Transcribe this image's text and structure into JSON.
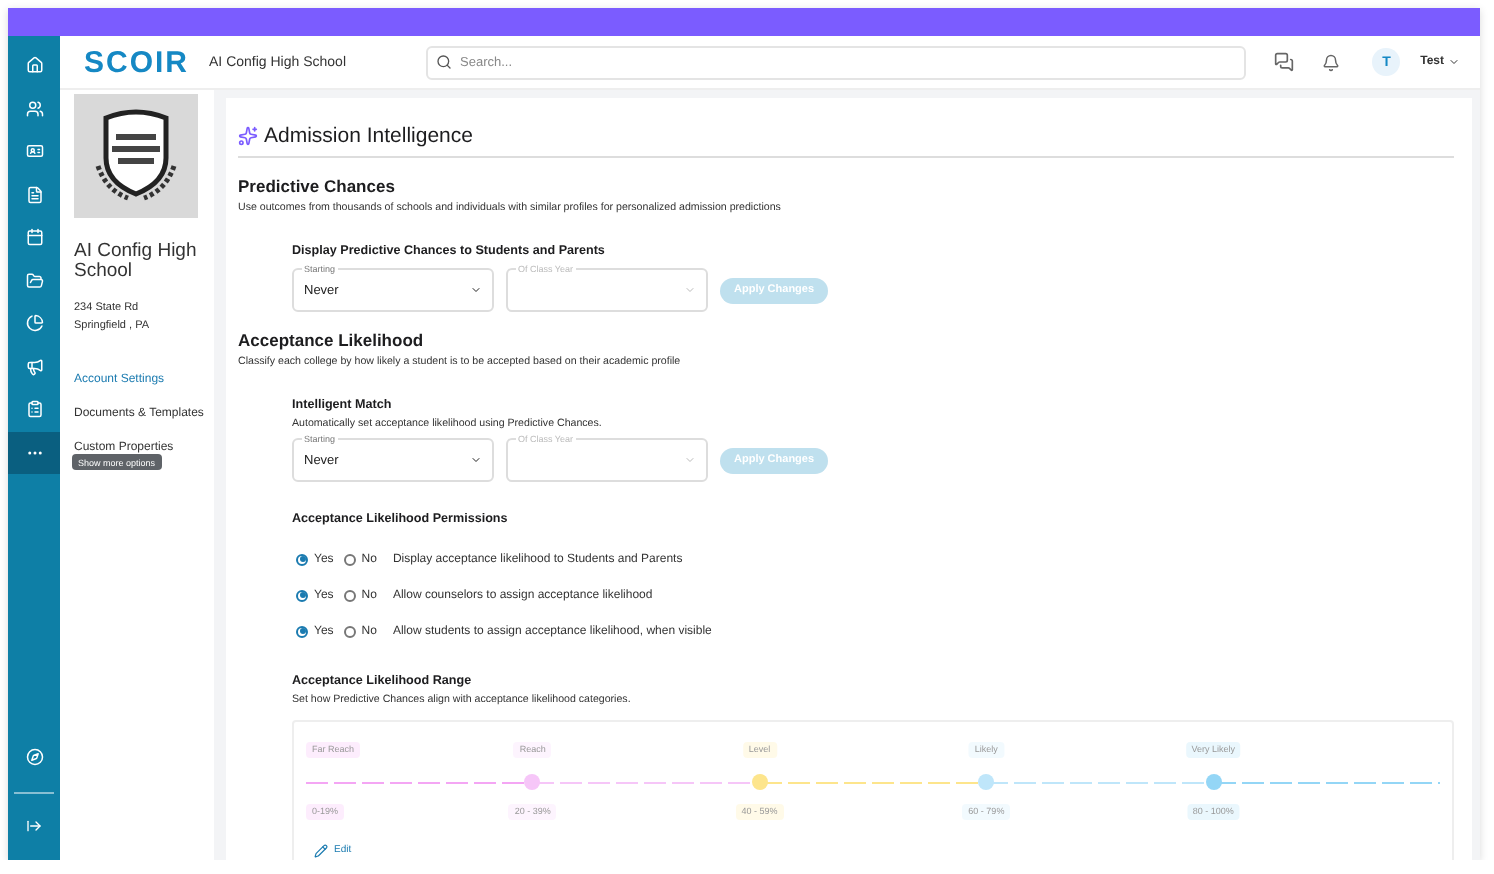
{
  "header": {
    "logo": "SCOIR",
    "school": "AI Config High School",
    "search": {
      "placeholder": "Search..."
    },
    "user": {
      "initial": "T",
      "name": "Test"
    }
  },
  "rail": {
    "items": [
      {
        "selected": false
      },
      {
        "selected": false
      },
      {
        "selected": false
      },
      {
        "selected": false
      },
      {
        "selected": false
      },
      {
        "selected": false
      },
      {
        "selected": false
      },
      {
        "selected": false
      },
      {
        "selected": false
      },
      {
        "selected": true
      }
    ],
    "tooltip": "Show more options"
  },
  "profile": {
    "logo": {
      "kind": "picture"
    },
    "name": "AI Config High School",
    "address": [
      "234 State Rd",
      "Springfield , PA"
    ],
    "links": [
      {
        "label": "Account Settings",
        "selected": true
      },
      {
        "label": "Documents & Templates",
        "selected": false
      },
      {
        "label": "Custom Properties",
        "selected": false
      }
    ]
  },
  "page": {
    "title": "Admission Intelligence",
    "sections": [
      {
        "title": "Predictive Chances",
        "description": "Use outcomes from thousands of schools and individuals with similar profiles for personalized admission predictions",
        "blocks": [
          {
            "kind": "selects",
            "title": "Display Predictive Chances to Students and Parents",
            "selects": [
              {
                "label": "Starting",
                "value": "Never",
                "disabled": false
              },
              {
                "label": "Of Class Year",
                "disabled": true
              }
            ],
            "button": {
              "label": "Apply Changes",
              "disabled": true
            }
          }
        ]
      },
      {
        "title": "Acceptance Likelihood",
        "description": "Classify each college by how likely a student is to be accepted based on their academic profile",
        "blocks": [
          {
            "kind": "selects",
            "title": "Intelligent Match",
            "description": "Automatically set acceptance likelihood using Predictive Chances.",
            "selects": [
              {
                "label": "Starting",
                "value": "Never",
                "disabled": false
              },
              {
                "label": "Of Class Year",
                "disabled": true
              }
            ],
            "button": {
              "label": "Apply Changes",
              "disabled": true
            }
          },
          {
            "kind": "radios",
            "title": "Acceptance Likelihood Permissions",
            "rows": [
              {
                "text": "Display acceptance likelihood to Students and Parents",
                "options": [
                  {
                    "label": "Yes",
                    "selected": true
                  },
                  {
                    "label": "No",
                    "selected": false
                  }
                ]
              },
              {
                "text": "Allow counselors to assign acceptance likelihood",
                "options": [
                  {
                    "label": "Yes",
                    "selected": true
                  },
                  {
                    "label": "No",
                    "selected": false
                  }
                ]
              },
              {
                "text": "Allow students to assign acceptance likelihood, when visible",
                "options": [
                  {
                    "label": "Yes",
                    "selected": true
                  },
                  {
                    "label": "No",
                    "selected": false
                  }
                ]
              }
            ]
          },
          {
            "kind": "range",
            "title": "Acceptance Likelihood Range",
            "description": "Set how Predictive Chances align with acceptance likelihood categories.",
            "edit": "Edit",
            "categories": [
              {
                "label": "Far Reach",
                "range": "0-19%",
                "color": "#f4a6f4"
              },
              {
                "label": "Reach",
                "range": "20 - 39%",
                "color": "#f6c6f8",
                "level": 0.2
              },
              {
                "label": "Level",
                "range": "40 - 59%",
                "color": "#fde58c",
                "level": 0.4
              },
              {
                "label": "Likely",
                "range": "60 - 79%",
                "color": "#bfe6fa",
                "level": 0.6
              },
              {
                "label": "Very Likely",
                "range": "80 - 100%",
                "color": "#94d6f6",
                "level": 0.8
              }
            ]
          }
        ]
      }
    ]
  }
}
